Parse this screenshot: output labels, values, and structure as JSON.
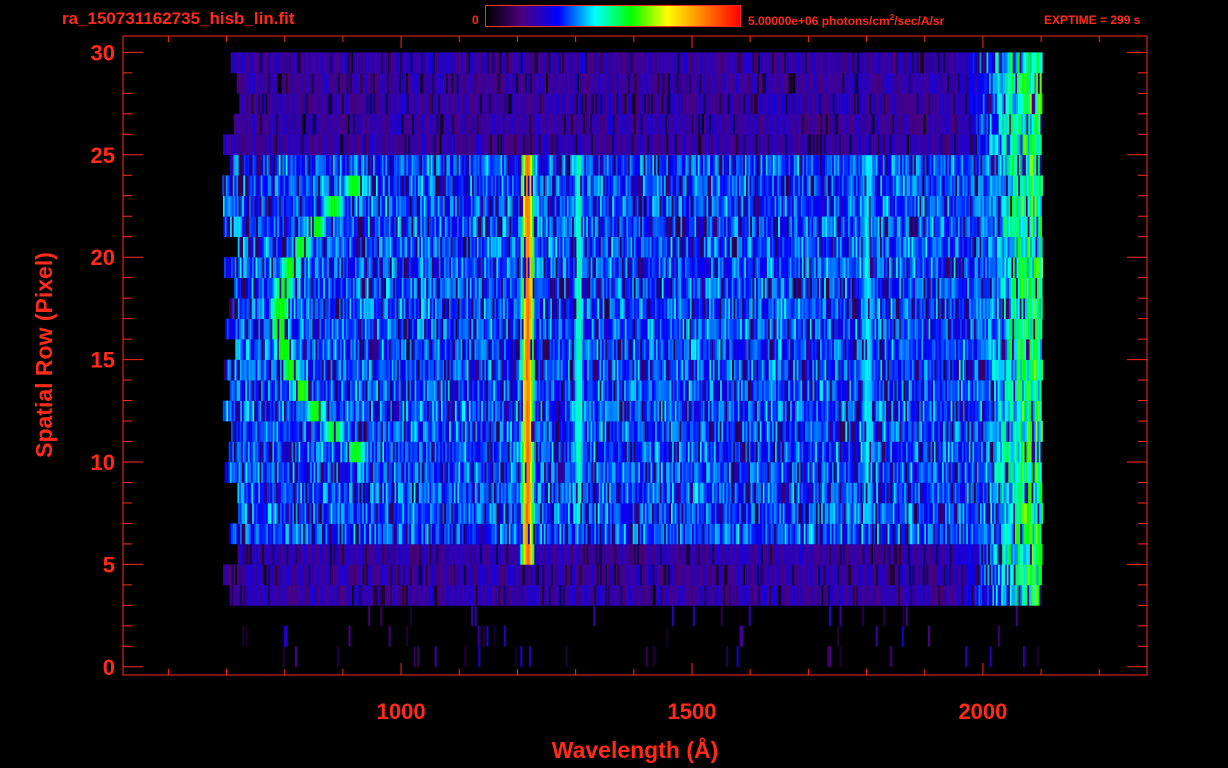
{
  "header": {
    "filename": "ra_150731162735_hisb_lin.fit",
    "colorbar_min": "0",
    "colorbar_max_prefix": "5.00000e+06 photons/cm",
    "colorbar_max_sup": "2",
    "colorbar_max_suffix": "/sec/A/sr",
    "exptime": "EXPTIME = 299 s"
  },
  "colors": {
    "text": "#ff2a1a",
    "colormap": [
      "#000000",
      "#4b0082",
      "#0000ff",
      "#00ffff",
      "#00ff00",
      "#ffff00",
      "#ff8000",
      "#ff0000"
    ]
  },
  "chart_data": {
    "type": "heatmap",
    "xlabel": "Wavelength (Å)",
    "ylabel": "Spatial Row (Pixel)",
    "xlim": [
      522,
      2282
    ],
    "ylim": [
      -0.4,
      30.8
    ],
    "x_ticks": [
      1000,
      1500,
      2000
    ],
    "y_ticks": [
      0,
      5,
      10,
      15,
      20,
      25,
      30
    ],
    "colorbar_range": [
      0,
      5000000
    ],
    "data_extent_wavelength": [
      690,
      2100
    ],
    "data_extent_rows": [
      0,
      30
    ],
    "features": [
      {
        "type": "emission_line",
        "wavelength": 1216,
        "rows": [
          5,
          24
        ],
        "peak_level": 0.85
      },
      {
        "type": "emission_line",
        "wavelength": 1304,
        "rows": [
          7,
          24
        ],
        "peak_level": 0.45
      },
      {
        "type": "emission_band",
        "wavelength": 1800,
        "rows": [
          7,
          24
        ],
        "peak_level": 0.4
      },
      {
        "type": "arc",
        "wavelength_range": [
          780,
          950
        ],
        "rows": [
          10,
          23
        ],
        "peak_level": 0.55
      },
      {
        "type": "continuum_rise",
        "wavelength_range": [
          1900,
          2070
        ],
        "rows": [
          3,
          30
        ],
        "peak_level": 0.6
      }
    ]
  }
}
